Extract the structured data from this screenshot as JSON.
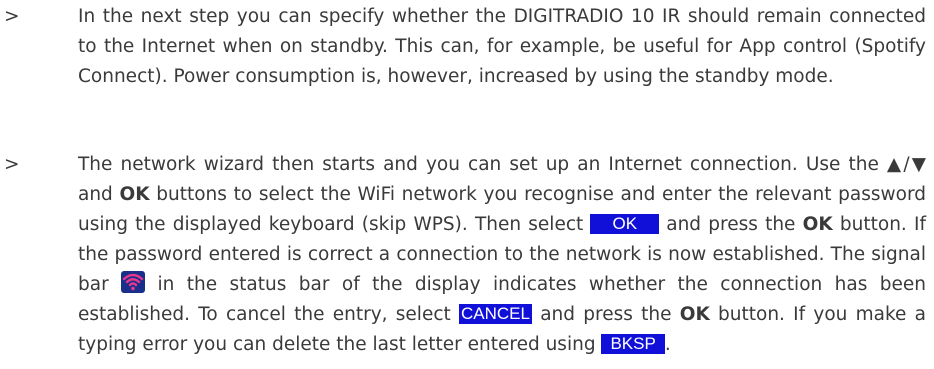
{
  "bullet_marker": ">",
  "paragraph1": {
    "text": "In the next step you can specify whether the DIGITRADIO 10 IR should remain connected to the Internet when on standby. This can, for example, be useful for App control (Spotify Connect). Power consumption is, however, increased by using the standby mode."
  },
  "paragraph2": {
    "p1": "The network wizard then starts and you can set up an Internet connection. Use the ",
    "arrows": "▲/▼",
    "p2": " and ",
    "ok_bold_1": "OK",
    "p3": " buttons to select the WiFi network you recognise and enter the relevant password using the displayed keyboard (skip WPS). Then select ",
    "key_ok": "OK",
    "p4": " and press the ",
    "ok_bold_2": "OK",
    "p5": " button. If the password entered is correct a connection to the network is now established. The signal bar ",
    "signal_icon": "wifi-signal-icon",
    "p6": " in the status bar of the display indicates whether the connection has been established. To cancel the entry, select ",
    "key_cancel": "CANCEL",
    "p7": " and press the ",
    "ok_bold_3": "OK",
    "p8": " button. If you make a typing error you can delete the last letter entered using ",
    "key_bksp": "BKSP",
    "p9": "."
  },
  "colors": {
    "text": "#3a3a3a",
    "key_background": "#1010d8",
    "key_text": "#ffffff",
    "icon_background": "#1a2f8a",
    "icon_signal": "#e8368f"
  }
}
